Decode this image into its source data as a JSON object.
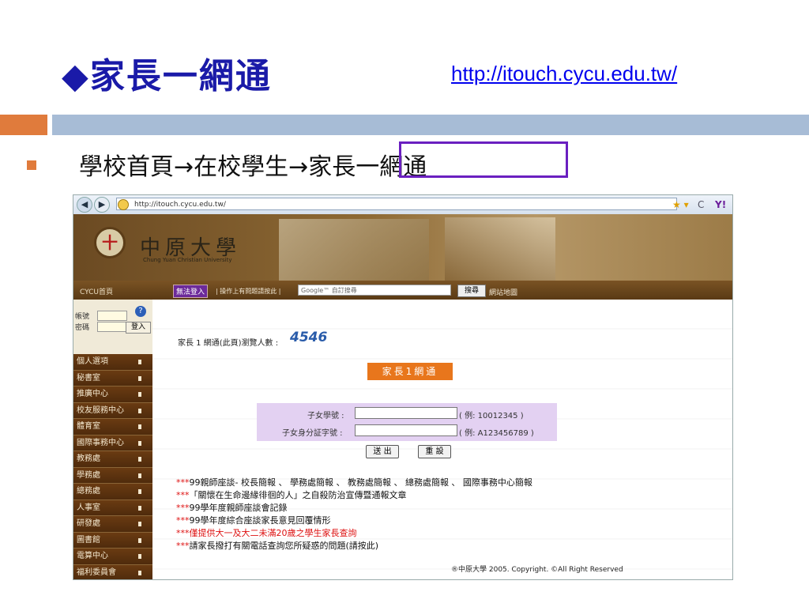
{
  "slide": {
    "title": "◆家長一網通",
    "url": "http://itouch.cycu.edu.tw/",
    "bullet": "學校首頁→在校學生→家長一網通"
  },
  "browser": {
    "back_icon": "back-arrow-icon",
    "forward_icon": "forward-arrow-icon",
    "address": "http://itouch.cycu.edu.tw/",
    "star_icon": "★ ▾",
    "refresh_icon": "C",
    "yahoo_icon": "Y!"
  },
  "site": {
    "logo_glyph": "十",
    "university_name": "中原大學",
    "university_en": "Chung Yuan Christian University",
    "nav": {
      "home": "CYCU首頁",
      "login_problem": "無法登入",
      "help_text": "| 操作上有問題請按此 |",
      "search_placeholder": "Google™ 自訂搜尋",
      "search_button": "搜尋",
      "sitemap": "網站地圖"
    },
    "login": {
      "account_label": "帳號",
      "password_label": "密碼",
      "help": "?",
      "submit": "登入"
    },
    "menu": [
      {
        "label": "個人選項"
      },
      {
        "label": "秘書室"
      },
      {
        "label": "推廣中心"
      },
      {
        "label": "校友服務中心"
      },
      {
        "label": "體育室"
      },
      {
        "label": "國際事務中心"
      },
      {
        "label": "教務處"
      },
      {
        "label": "學務處"
      },
      {
        "label": "總務處"
      },
      {
        "label": "人事室"
      },
      {
        "label": "研發處"
      },
      {
        "label": "圖書館"
      },
      {
        "label": "電算中心"
      },
      {
        "label": "福利委員會"
      }
    ],
    "views_label": "家長 1 網通(此頁)瀏覽人數 :",
    "views_count": "4546",
    "family_title": "家長1網通",
    "form": {
      "student_id_label": "子女學號 :",
      "student_id_hint": "( 例: 10012345 )",
      "id_card_label": "子女身分証字號 :",
      "id_card_hint": "( 例: A123456789 )",
      "submit": "送 出",
      "reset": "重 設"
    },
    "news": [
      {
        "stars": "***",
        "text": "99親師座談- 校長簡報 、 學務處簡報 、 教務處簡報 、 總務處簡報 、 國際事務中心簡報"
      },
      {
        "stars": "***",
        "text": "「關懷在生命邊緣徘徊的人」之自殺防治宣傳暨通報文章"
      },
      {
        "stars": "***",
        "text": "99學年度親師座談會記錄"
      },
      {
        "stars": "***",
        "text": "99學年度綜合座談家長意見回覆情形"
      },
      {
        "stars": "***",
        "text": "僅提供大一及大二未滿20歲之學生家長查詢"
      },
      {
        "stars": "***",
        "text": "請家長撥打有關電話查詢您所疑惑的問題(請按此)"
      }
    ],
    "copyright": "®中原大學 2005. Copyright. ©All Right Reserved"
  },
  "colors": {
    "title_blue": "#1a1aa8",
    "accent_orange": "#e07b3c",
    "highlight_purple": "#6a1fc0",
    "menu_brown": "#5a3a15"
  }
}
